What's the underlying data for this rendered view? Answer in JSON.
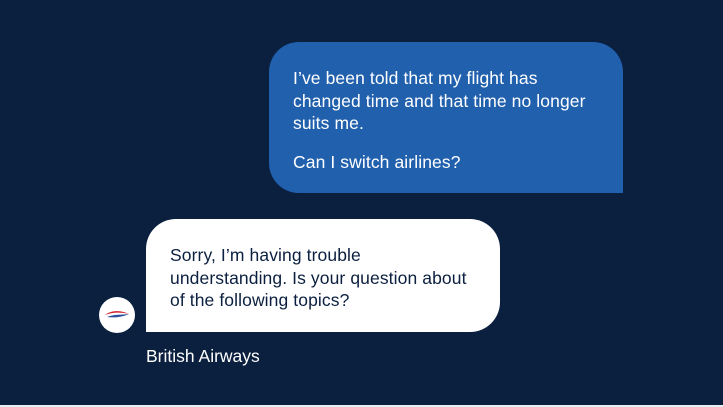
{
  "conversation": {
    "user_message": {
      "paragraph_1": "I’ve been told that my flight has changed time and that time no longer suits me.",
      "paragraph_2": "Can I switch airlines?"
    },
    "bot_message": {
      "text": "Sorry, I’m having trouble understanding. Is your question about of the following topics?",
      "sender": "British Airways",
      "avatar_icon": "british-airways-speedmarque-logo"
    }
  },
  "colors": {
    "background": "#0b1f3f",
    "user_bubble": "#2160ad",
    "bot_bubble": "#ffffff",
    "brand_red": "#d4202c",
    "brand_blue": "#2c4f9e"
  }
}
